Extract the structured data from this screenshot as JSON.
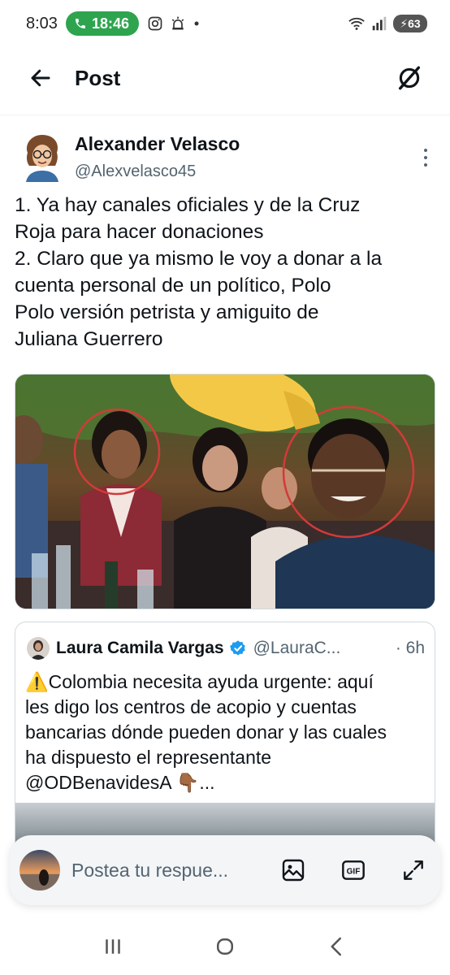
{
  "status_bar": {
    "time": "8:03",
    "call_timer": "18:46",
    "battery": "63"
  },
  "header": {
    "title": "Post",
    "back_icon": "arrow-left-icon",
    "action_icon": "grok-icon"
  },
  "post": {
    "author_name": "Alexander Velasco",
    "author_handle": "@Alexvelasco45",
    "text_lines": [
      "1. Ya hay canales oficiales y de la Cruz",
      "Roja para hacer donaciones",
      "2. Claro que ya mismo le voy a donar a la",
      "cuenta personal de un político, Polo",
      "Polo versión petrista y amiguito de",
      "Juliana Guerrero"
    ]
  },
  "quote": {
    "author_name": "Laura Camila Vargas",
    "author_handle": "@LauraC...",
    "time": "· 6h",
    "text_lines": [
      "⚠️Colombia necesita ayuda urgente: aquí",
      "les digo los centros de acopio y cuentas",
      "bancarias dónde pueden donar y las cuales",
      "ha dispuesto el representante",
      "@ODBenavidesA 👇🏾..."
    ]
  },
  "reply": {
    "placeholder": "Postea tu respue...",
    "icons": [
      "image-icon",
      "gif-icon",
      "expand-icon"
    ]
  },
  "colors": {
    "text_primary": "#0f1419",
    "text_secondary": "#536471",
    "verified_blue": "#1d9bf0",
    "call_green": "#2ea44f"
  }
}
